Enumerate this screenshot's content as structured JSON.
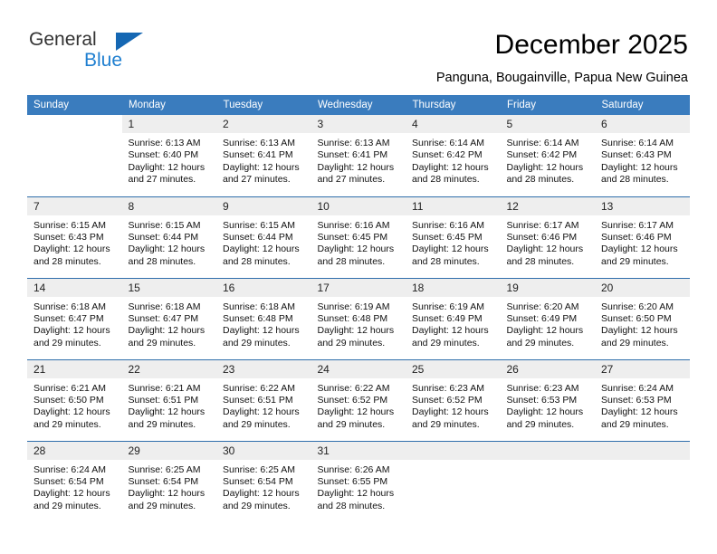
{
  "branding": {
    "name_part1": "General",
    "name_part2": "Blue",
    "triangle_color": "#1567b3",
    "blue_text_color": "#1f7fd0"
  },
  "header": {
    "title": "December 2025",
    "location": "Panguna, Bougainville, Papua New Guinea"
  },
  "theme": {
    "header_bg": "#3a7cbe",
    "header_text": "#ffffff",
    "daynum_bg": "#eeeeee",
    "week_separator": "#2f6eab",
    "cell_bg": "#ffffff"
  },
  "weekday_headers": [
    "Sunday",
    "Monday",
    "Tuesday",
    "Wednesday",
    "Thursday",
    "Friday",
    "Saturday"
  ],
  "labels": {
    "sunrise_prefix": "Sunrise:",
    "sunset_prefix": "Sunset:",
    "daylight_prefix": "Daylight:"
  },
  "weeks": [
    [
      {
        "blank": true
      },
      {
        "day": "1",
        "sunrise": "Sunrise: 6:13 AM",
        "sunset": "Sunset: 6:40 PM",
        "daylight_line1": "Daylight: 12 hours",
        "daylight_line2": "and 27 minutes."
      },
      {
        "day": "2",
        "sunrise": "Sunrise: 6:13 AM",
        "sunset": "Sunset: 6:41 PM",
        "daylight_line1": "Daylight: 12 hours",
        "daylight_line2": "and 27 minutes."
      },
      {
        "day": "3",
        "sunrise": "Sunrise: 6:13 AM",
        "sunset": "Sunset: 6:41 PM",
        "daylight_line1": "Daylight: 12 hours",
        "daylight_line2": "and 27 minutes."
      },
      {
        "day": "4",
        "sunrise": "Sunrise: 6:14 AM",
        "sunset": "Sunset: 6:42 PM",
        "daylight_line1": "Daylight: 12 hours",
        "daylight_line2": "and 28 minutes."
      },
      {
        "day": "5",
        "sunrise": "Sunrise: 6:14 AM",
        "sunset": "Sunset: 6:42 PM",
        "daylight_line1": "Daylight: 12 hours",
        "daylight_line2": "and 28 minutes."
      },
      {
        "day": "6",
        "sunrise": "Sunrise: 6:14 AM",
        "sunset": "Sunset: 6:43 PM",
        "daylight_line1": "Daylight: 12 hours",
        "daylight_line2": "and 28 minutes."
      }
    ],
    [
      {
        "day": "7",
        "sunrise": "Sunrise: 6:15 AM",
        "sunset": "Sunset: 6:43 PM",
        "daylight_line1": "Daylight: 12 hours",
        "daylight_line2": "and 28 minutes."
      },
      {
        "day": "8",
        "sunrise": "Sunrise: 6:15 AM",
        "sunset": "Sunset: 6:44 PM",
        "daylight_line1": "Daylight: 12 hours",
        "daylight_line2": "and 28 minutes."
      },
      {
        "day": "9",
        "sunrise": "Sunrise: 6:15 AM",
        "sunset": "Sunset: 6:44 PM",
        "daylight_line1": "Daylight: 12 hours",
        "daylight_line2": "and 28 minutes."
      },
      {
        "day": "10",
        "sunrise": "Sunrise: 6:16 AM",
        "sunset": "Sunset: 6:45 PM",
        "daylight_line1": "Daylight: 12 hours",
        "daylight_line2": "and 28 minutes."
      },
      {
        "day": "11",
        "sunrise": "Sunrise: 6:16 AM",
        "sunset": "Sunset: 6:45 PM",
        "daylight_line1": "Daylight: 12 hours",
        "daylight_line2": "and 28 minutes."
      },
      {
        "day": "12",
        "sunrise": "Sunrise: 6:17 AM",
        "sunset": "Sunset: 6:46 PM",
        "daylight_line1": "Daylight: 12 hours",
        "daylight_line2": "and 28 minutes."
      },
      {
        "day": "13",
        "sunrise": "Sunrise: 6:17 AM",
        "sunset": "Sunset: 6:46 PM",
        "daylight_line1": "Daylight: 12 hours",
        "daylight_line2": "and 29 minutes."
      }
    ],
    [
      {
        "day": "14",
        "sunrise": "Sunrise: 6:18 AM",
        "sunset": "Sunset: 6:47 PM",
        "daylight_line1": "Daylight: 12 hours",
        "daylight_line2": "and 29 minutes."
      },
      {
        "day": "15",
        "sunrise": "Sunrise: 6:18 AM",
        "sunset": "Sunset: 6:47 PM",
        "daylight_line1": "Daylight: 12 hours",
        "daylight_line2": "and 29 minutes."
      },
      {
        "day": "16",
        "sunrise": "Sunrise: 6:18 AM",
        "sunset": "Sunset: 6:48 PM",
        "daylight_line1": "Daylight: 12 hours",
        "daylight_line2": "and 29 minutes."
      },
      {
        "day": "17",
        "sunrise": "Sunrise: 6:19 AM",
        "sunset": "Sunset: 6:48 PM",
        "daylight_line1": "Daylight: 12 hours",
        "daylight_line2": "and 29 minutes."
      },
      {
        "day": "18",
        "sunrise": "Sunrise: 6:19 AM",
        "sunset": "Sunset: 6:49 PM",
        "daylight_line1": "Daylight: 12 hours",
        "daylight_line2": "and 29 minutes."
      },
      {
        "day": "19",
        "sunrise": "Sunrise: 6:20 AM",
        "sunset": "Sunset: 6:49 PM",
        "daylight_line1": "Daylight: 12 hours",
        "daylight_line2": "and 29 minutes."
      },
      {
        "day": "20",
        "sunrise": "Sunrise: 6:20 AM",
        "sunset": "Sunset: 6:50 PM",
        "daylight_line1": "Daylight: 12 hours",
        "daylight_line2": "and 29 minutes."
      }
    ],
    [
      {
        "day": "21",
        "sunrise": "Sunrise: 6:21 AM",
        "sunset": "Sunset: 6:50 PM",
        "daylight_line1": "Daylight: 12 hours",
        "daylight_line2": "and 29 minutes."
      },
      {
        "day": "22",
        "sunrise": "Sunrise: 6:21 AM",
        "sunset": "Sunset: 6:51 PM",
        "daylight_line1": "Daylight: 12 hours",
        "daylight_line2": "and 29 minutes."
      },
      {
        "day": "23",
        "sunrise": "Sunrise: 6:22 AM",
        "sunset": "Sunset: 6:51 PM",
        "daylight_line1": "Daylight: 12 hours",
        "daylight_line2": "and 29 minutes."
      },
      {
        "day": "24",
        "sunrise": "Sunrise: 6:22 AM",
        "sunset": "Sunset: 6:52 PM",
        "daylight_line1": "Daylight: 12 hours",
        "daylight_line2": "and 29 minutes."
      },
      {
        "day": "25",
        "sunrise": "Sunrise: 6:23 AM",
        "sunset": "Sunset: 6:52 PM",
        "daylight_line1": "Daylight: 12 hours",
        "daylight_line2": "and 29 minutes."
      },
      {
        "day": "26",
        "sunrise": "Sunrise: 6:23 AM",
        "sunset": "Sunset: 6:53 PM",
        "daylight_line1": "Daylight: 12 hours",
        "daylight_line2": "and 29 minutes."
      },
      {
        "day": "27",
        "sunrise": "Sunrise: 6:24 AM",
        "sunset": "Sunset: 6:53 PM",
        "daylight_line1": "Daylight: 12 hours",
        "daylight_line2": "and 29 minutes."
      }
    ],
    [
      {
        "day": "28",
        "sunrise": "Sunrise: 6:24 AM",
        "sunset": "Sunset: 6:54 PM",
        "daylight_line1": "Daylight: 12 hours",
        "daylight_line2": "and 29 minutes."
      },
      {
        "day": "29",
        "sunrise": "Sunrise: 6:25 AM",
        "sunset": "Sunset: 6:54 PM",
        "daylight_line1": "Daylight: 12 hours",
        "daylight_line2": "and 29 minutes."
      },
      {
        "day": "30",
        "sunrise": "Sunrise: 6:25 AM",
        "sunset": "Sunset: 6:54 PM",
        "daylight_line1": "Daylight: 12 hours",
        "daylight_line2": "and 29 minutes."
      },
      {
        "day": "31",
        "sunrise": "Sunrise: 6:26 AM",
        "sunset": "Sunset: 6:55 PM",
        "daylight_line1": "Daylight: 12 hours",
        "daylight_line2": "and 28 minutes."
      },
      {
        "empty": true
      },
      {
        "empty": true
      },
      {
        "empty": true
      }
    ]
  ]
}
